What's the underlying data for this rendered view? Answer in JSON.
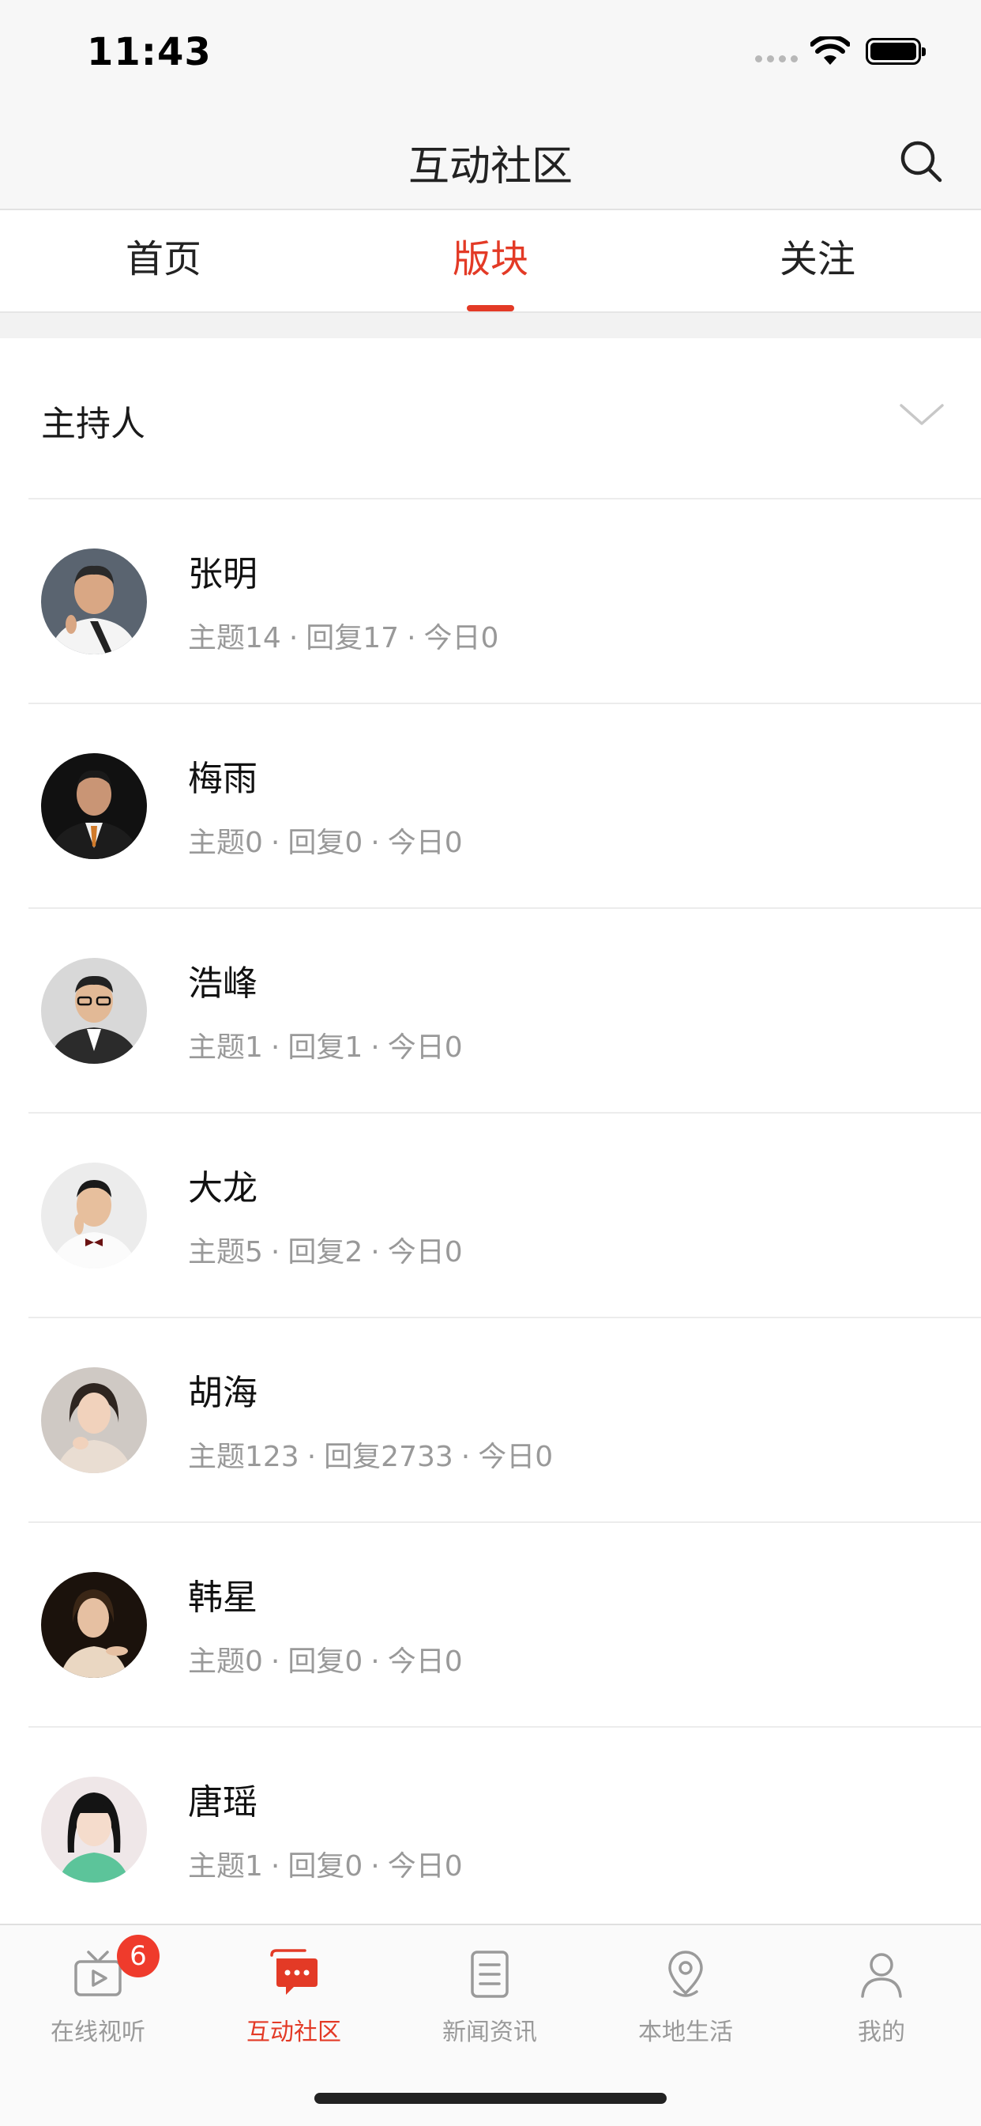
{
  "status_bar": {
    "time": "11:43"
  },
  "header": {
    "title": "互动社区"
  },
  "tabs": [
    {
      "label": "首页",
      "active": false
    },
    {
      "label": "版块",
      "active": true
    },
    {
      "label": "关注",
      "active": false
    }
  ],
  "section": {
    "title": "主持人"
  },
  "hosts": [
    {
      "name": "张明",
      "topics": "主题14",
      "replies": "回复17",
      "today": "今日0"
    },
    {
      "name": "梅雨",
      "topics": "主题0",
      "replies": "回复0",
      "today": "今日0"
    },
    {
      "name": "浩峰",
      "topics": "主题1",
      "replies": "回复1",
      "today": "今日0"
    },
    {
      "name": "大龙",
      "topics": "主题5",
      "replies": "回复2",
      "today": "今日0"
    },
    {
      "name": "胡海",
      "topics": "主题123",
      "replies": "回复2733",
      "today": "今日0"
    },
    {
      "name": "韩星",
      "topics": "主题0",
      "replies": "回复0",
      "today": "今日0"
    },
    {
      "name": "唐瑶",
      "topics": "主题1",
      "replies": "回复0",
      "today": "今日0"
    }
  ],
  "stat_separator": "·",
  "bottom_tabs": [
    {
      "label": "在线视听",
      "icon": "tv-play-icon",
      "badge": "6"
    },
    {
      "label": "互动社区",
      "icon": "chat-bubble-icon",
      "active": true
    },
    {
      "label": "新闻资讯",
      "icon": "news-list-icon"
    },
    {
      "label": "本地生活",
      "icon": "location-pin-icon"
    },
    {
      "label": "我的",
      "icon": "person-icon"
    }
  ],
  "colors": {
    "accent": "#e33a26",
    "badge": "#ef3b2c",
    "muted_text": "#999999"
  }
}
